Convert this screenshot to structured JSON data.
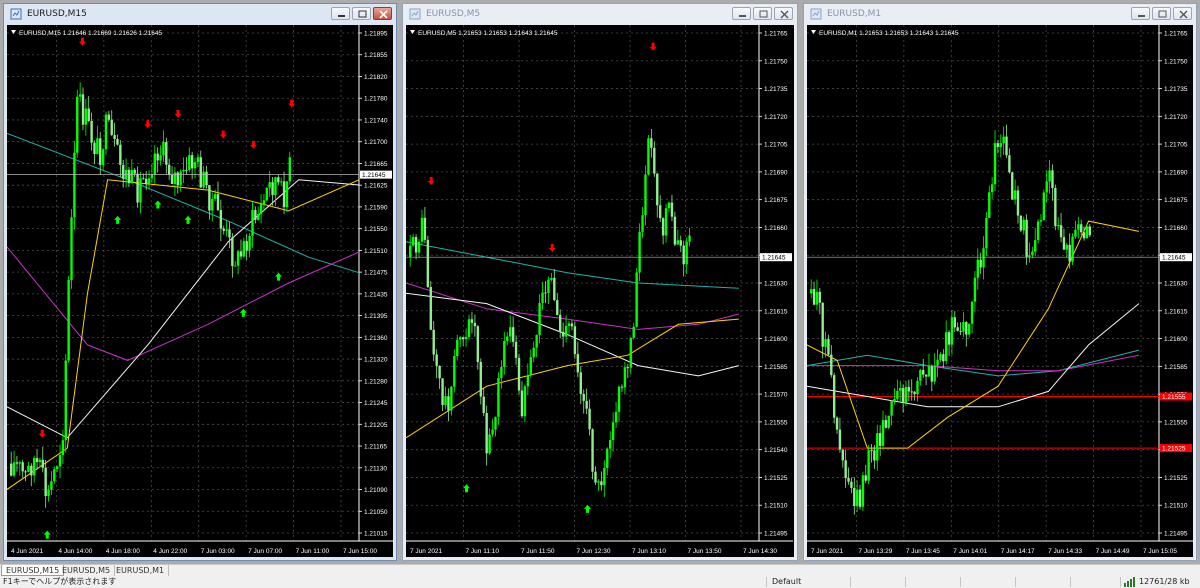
{
  "windows": [
    {
      "title": "EURUSD,M15",
      "ohlc": "EURUSD,M15  1.21646 1.21669 1.21626 1.21645",
      "current_price": "1.21645",
      "y_ticks": [
        "1.21895",
        "1.21855",
        "1.21820",
        "1.21780",
        "1.21740",
        "1.21700",
        "1.21665",
        "1.21625",
        "1.21590",
        "1.21550",
        "1.21510",
        "1.21475",
        "1.21435",
        "1.21395",
        "1.21360",
        "1.21320",
        "1.21280",
        "1.21245",
        "1.21205",
        "1.21165",
        "1.21130",
        "1.21090",
        "1.21050",
        "1.21015"
      ],
      "x_ticks": [
        "4 Jun 2021",
        "4 Jun 14:00",
        "4 Jun 18:00",
        "4 Jun 22:00",
        "7 Jun 03:00",
        "7 Jun 07:00",
        "7 Jun 11:00",
        "7 Jun 15:00"
      ]
    },
    {
      "title": "EURUSD,M5",
      "ohlc": "EURUSD,M5  1.21653 1.21653 1.21643 1.21645",
      "current_price": "1.21645",
      "y_ticks": [
        "1.21765",
        "1.21750",
        "1.21735",
        "1.21720",
        "1.21705",
        "1.21690",
        "1.21675",
        "1.21660",
        "1.21645",
        "1.21630",
        "1.21615",
        "1.21600",
        "1.21585",
        "1.21570",
        "1.21555",
        "1.21540",
        "1.21525",
        "1.21510",
        "1.21495"
      ],
      "x_ticks": [
        "7 Jun 2021",
        "7 Jun 11:10",
        "7 Jun 11:50",
        "7 Jun 12:30",
        "7 Jun 13:10",
        "7 Jun 13:50",
        "7 Jun 14:30"
      ]
    },
    {
      "title": "EURUSD,M1",
      "ohlc": "EURUSD,M1  1.21653 1.21653 1.21643 1.21645",
      "current_price": "1.21645",
      "hlines": [
        "1.21555",
        "1.21525"
      ],
      "y_ticks": [
        "1.21765",
        "1.21750",
        "1.21735",
        "1.21720",
        "1.21705",
        "1.21690",
        "1.21675",
        "1.21660",
        "1.21645",
        "1.21630",
        "1.21615",
        "1.21600",
        "1.21585",
        "1.21570",
        "1.21555",
        "1.21540",
        "1.21525",
        "1.21510",
        "1.21495"
      ],
      "x_ticks": [
        "7 Jun 2021",
        "7 Jun 13:29",
        "7 Jun 13:45",
        "7 Jun 14:01",
        "7 Jun 14:17",
        "7 Jun 14:33",
        "7 Jun 14:49",
        "7 Jun 15:05"
      ]
    }
  ],
  "tabs": [
    "EURUSD,M15",
    "EURUSD,M5",
    "EURUSD,M1"
  ],
  "status": {
    "help": "F1キーでヘルプが表示されます",
    "profile": "Default",
    "traffic": "12761/28 kb"
  },
  "colors": {
    "candle_up": "#00ff00",
    "candle_down": "#90ee90",
    "ma_fast": "#ffd400",
    "ma_mid": "#f5f5f5",
    "ma_slow": "#20b2aa",
    "ma_long": "#c832c8",
    "arrow_up": "#00ff00",
    "arrow_down": "#ff0000",
    "hline": "#ff0000"
  }
}
